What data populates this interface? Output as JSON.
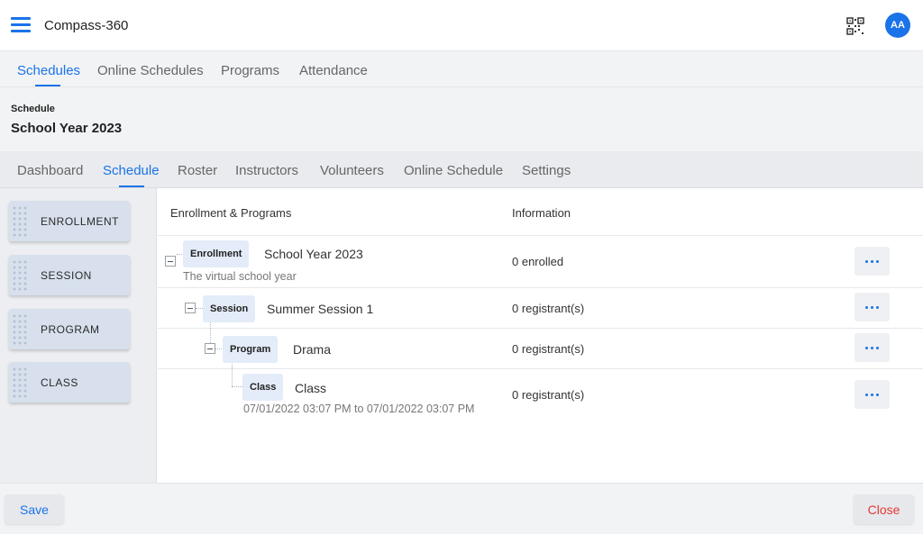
{
  "app": {
    "title": "Compass-360",
    "avatar_initials": "AA",
    "accent": "#1a73e8"
  },
  "main_tabs": [
    {
      "label": "Schedules",
      "active": true
    },
    {
      "label": "Online Schedules",
      "active": false
    },
    {
      "label": "Programs",
      "active": false
    },
    {
      "label": "Attendance",
      "active": false
    }
  ],
  "schedule": {
    "label": "Schedule",
    "title": "School Year 2023"
  },
  "sub_tabs": [
    {
      "label": "Dashboard",
      "active": false
    },
    {
      "label": "Schedule",
      "active": true
    },
    {
      "label": "Roster",
      "active": false
    },
    {
      "label": "Instructors",
      "active": false
    },
    {
      "label": "Volunteers",
      "active": false
    },
    {
      "label": "Online Schedule",
      "active": false
    },
    {
      "label": "Settings",
      "active": false
    }
  ],
  "palette": [
    {
      "label": "ENROLLMENT"
    },
    {
      "label": "SESSION"
    },
    {
      "label": "PROGRAM"
    },
    {
      "label": "CLASS"
    }
  ],
  "table": {
    "col_enrollment": "Enrollment & Programs",
    "col_information": "Information",
    "rows": [
      {
        "type": "Enrollment",
        "name": "School Year 2023",
        "sub": "The virtual school year",
        "info": "0 enrolled"
      },
      {
        "type": "Session",
        "name": "Summer Session 1",
        "info": "0 registrant(s)"
      },
      {
        "type": "Program",
        "name": "Drama",
        "info": "0 registrant(s)"
      },
      {
        "type": "Class",
        "name": "Class",
        "sub": "07/01/2022 03:07 PM to 07/01/2022 03:07 PM",
        "info": "0 registrant(s)"
      }
    ]
  },
  "footer": {
    "save_label": "Save",
    "close_label": "Close",
    "close_color": "#e53935"
  },
  "icons": {
    "menu": "hamburger-menu-icon",
    "qr": "qr-code-icon",
    "more": "more-horizontal-icon",
    "grip": "drag-grip-icon",
    "collapse": "collapse-minus-icon"
  }
}
